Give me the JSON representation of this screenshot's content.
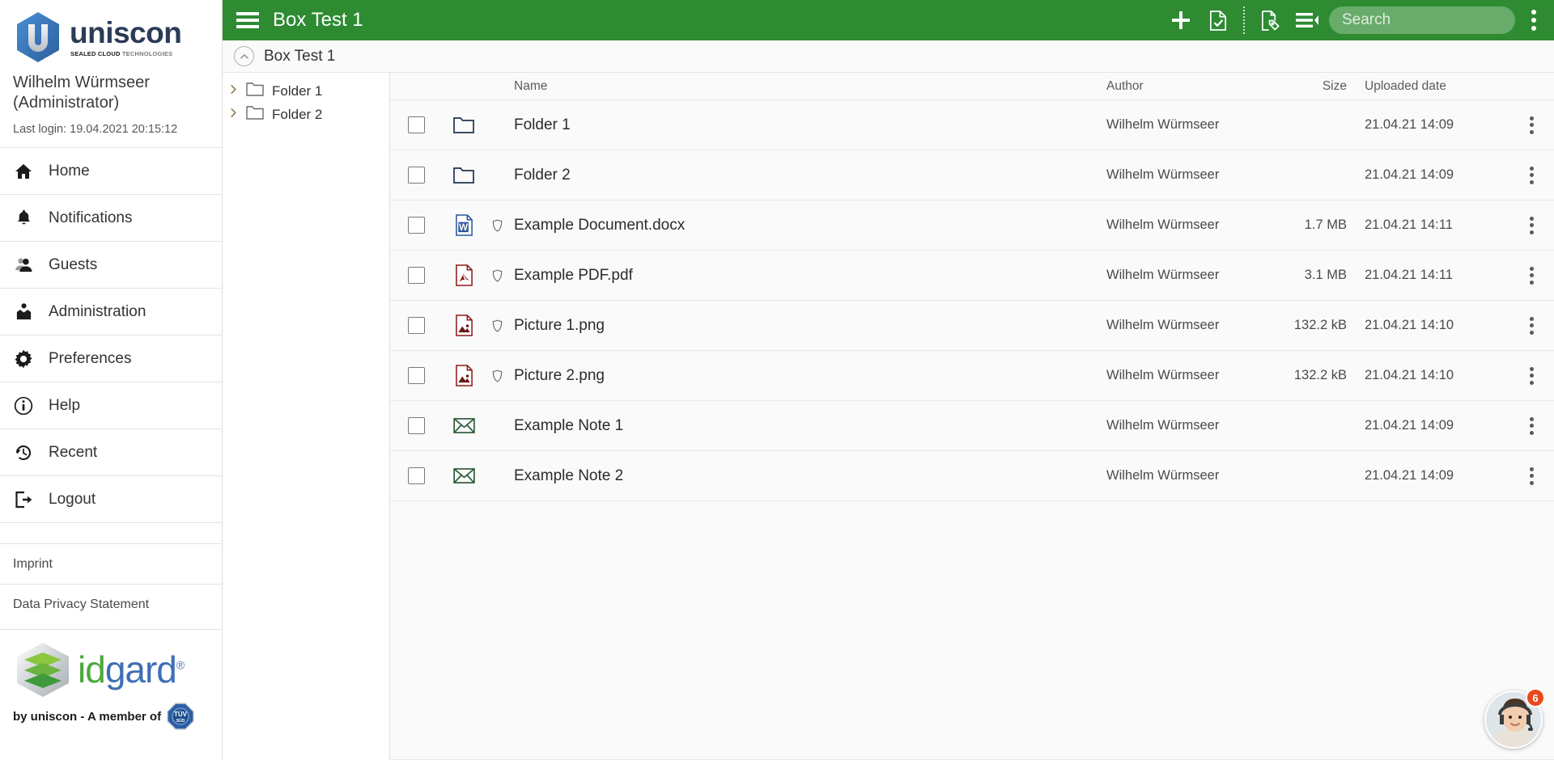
{
  "colors": {
    "header_green": "#2e8b32",
    "search_field": "rgba(255,255,255,0.28)",
    "badge_orange": "#e8491d",
    "idgard_green": "#4aa93b",
    "idgard_blue": "#3f6fb5"
  },
  "sidebar": {
    "logo": {
      "brand": "uniscon",
      "tagline_bold": "SEALED CLOUD",
      "tagline_light": "TECHNOLOGIES"
    },
    "user_name": "Wilhelm Würmseer\n(Administrator)",
    "last_login": "Last login: 19.04.2021 20:15:12",
    "nav": [
      {
        "label": "Home",
        "icon": "home-icon"
      },
      {
        "label": "Notifications",
        "icon": "bell-icon"
      },
      {
        "label": "Guests",
        "icon": "guests-icon"
      },
      {
        "label": "Administration",
        "icon": "administration-icon"
      },
      {
        "label": "Preferences",
        "icon": "gear-icon"
      },
      {
        "label": "Help",
        "icon": "info-icon"
      },
      {
        "label": "Recent",
        "icon": "recent-icon"
      },
      {
        "label": "Logout",
        "icon": "logout-icon"
      }
    ],
    "links": [
      {
        "label": "Imprint"
      },
      {
        "label": "Data Privacy Statement"
      }
    ],
    "footer_logo": {
      "word_first": "id",
      "word_second": "gard",
      "registered": "®",
      "byline": "by uniscon  -  A member of",
      "badge": "TÜV SÜD"
    }
  },
  "topbar": {
    "title": "Box Test 1",
    "menu_icon": "hamburger-icon",
    "actions": [
      {
        "name": "add-button",
        "icon": "plus-icon"
      },
      {
        "name": "new-file-button",
        "icon": "file-check-icon"
      },
      {
        "name": "tag-file-button",
        "icon": "file-tag-icon"
      },
      {
        "name": "sort-button",
        "icon": "sort-list-icon"
      }
    ],
    "search": {
      "value": "",
      "placeholder": "Search"
    },
    "overflow_icon": "kebab-icon"
  },
  "breadcrumb": {
    "up_icon": "chevron-up-circle-icon",
    "path": "Box Test 1"
  },
  "tree": {
    "items": [
      {
        "label": "Folder 1",
        "expand_icon": "chevron-right-icon",
        "icon": "folder-icon"
      },
      {
        "label": "Folder 2",
        "expand_icon": "chevron-right-icon",
        "icon": "folder-icon"
      }
    ]
  },
  "table": {
    "columns": {
      "name": "Name",
      "author": "Author",
      "size": "Size",
      "date": "Uploaded date"
    },
    "rows": [
      {
        "name": "Folder 1",
        "type": "folder",
        "shield": false,
        "author": "Wilhelm Würmseer",
        "size": "",
        "date": "21.04.21 14:09"
      },
      {
        "name": "Folder 2",
        "type": "folder",
        "shield": false,
        "author": "Wilhelm Würmseer",
        "size": "",
        "date": "21.04.21 14:09"
      },
      {
        "name": "Example Document.docx",
        "type": "word",
        "shield": true,
        "author": "Wilhelm Würmseer",
        "size": "1.7 MB",
        "date": "21.04.21 14:11"
      },
      {
        "name": "Example PDF.pdf",
        "type": "pdf",
        "shield": true,
        "author": "Wilhelm Würmseer",
        "size": "3.1 MB",
        "date": "21.04.21 14:11"
      },
      {
        "name": "Picture 1.png",
        "type": "image",
        "shield": true,
        "author": "Wilhelm Würmseer",
        "size": "132.2 kB",
        "date": "21.04.21 14:10"
      },
      {
        "name": "Picture 2.png",
        "type": "image",
        "shield": true,
        "author": "Wilhelm Würmseer",
        "size": "132.2 kB",
        "date": "21.04.21 14:10"
      },
      {
        "name": "Example Note 1",
        "type": "note",
        "shield": false,
        "author": "Wilhelm Würmseer",
        "size": "",
        "date": "21.04.21 14:09"
      },
      {
        "name": "Example Note 2",
        "type": "note",
        "shield": false,
        "author": "Wilhelm Würmseer",
        "size": "",
        "date": "21.04.21 14:09"
      }
    ]
  },
  "chat": {
    "badge_count": "6",
    "icon": "support-agent-avatar"
  }
}
